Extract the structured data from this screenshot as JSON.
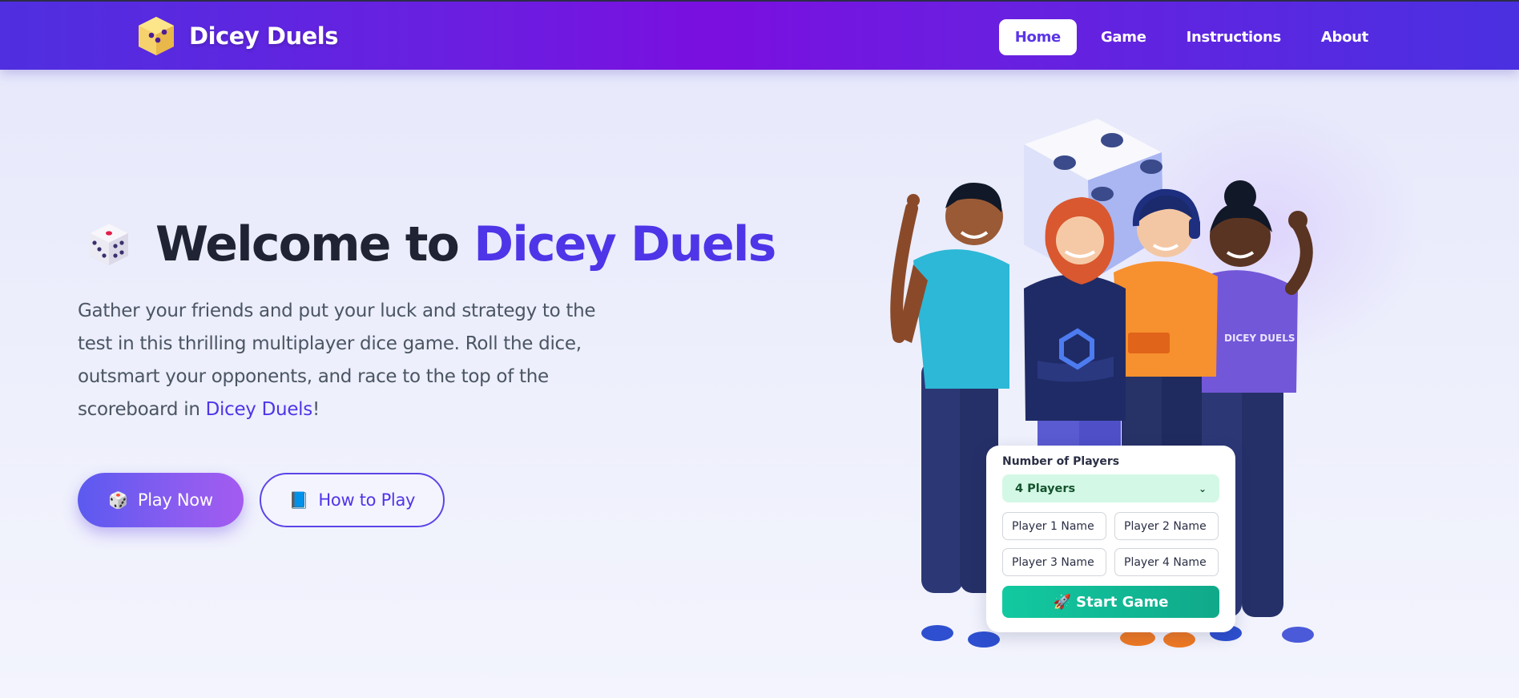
{
  "nav": {
    "brand": "Dicey Duels",
    "links": [
      {
        "label": "Home",
        "active": true
      },
      {
        "label": "Game",
        "active": false
      },
      {
        "label": "Instructions",
        "active": false
      },
      {
        "label": "About",
        "active": false
      }
    ]
  },
  "hero": {
    "title_prefix": "Welcome to ",
    "title_accent": "Dicey Duels",
    "description_main": "Gather your friends and put your luck and strategy to the test in this thrilling multiplayer dice game. Roll the dice, outsmart your opponents, and race to the top of the scoreboard in ",
    "description_accent": "Dicey Duels",
    "description_end": "!",
    "play_button": {
      "emoji": "🎲",
      "label": "Play Now"
    },
    "howto_button": {
      "emoji": "📘",
      "label": "How to Play"
    }
  },
  "illustration": {
    "shirt_text": "DICEY DUELS",
    "form": {
      "label": "Number of Players",
      "selected": "4 Players",
      "inputs": [
        "Player 1 Name",
        "Player 2 Name",
        "Player 3 Name",
        "Player 4 Name"
      ],
      "start_label": "🚀 Start Game"
    }
  },
  "colors": {
    "accent": "#4f35e8",
    "nav_start": "#4f2fe0",
    "nav_mid": "#7a0fe0",
    "start_green": "#12c9a0"
  }
}
